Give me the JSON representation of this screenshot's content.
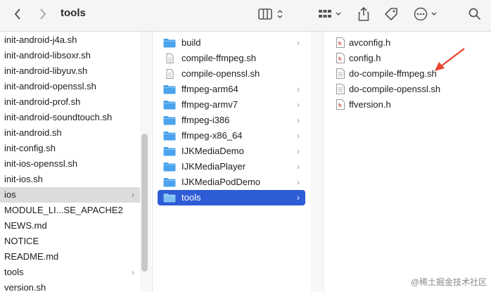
{
  "window": {
    "title": "tools"
  },
  "toolbar": {
    "back_icon": "chevron-left-icon",
    "forward_icon": "chevron-right-icon",
    "view_icon": "column-view-icon",
    "group_icon": "grid-group-icon",
    "share_icon": "share-icon",
    "tag_icon": "tag-icon",
    "more_icon": "ellipsis-icon",
    "search_icon": "search-icon"
  },
  "column1": {
    "items": [
      {
        "label": "init-android-j4a.sh",
        "folder": false
      },
      {
        "label": "init-android-libsoxr.sh",
        "folder": false
      },
      {
        "label": "init-android-libyuv.sh",
        "folder": false
      },
      {
        "label": "init-android-openssl.sh",
        "folder": false
      },
      {
        "label": "init-android-prof.sh",
        "folder": false
      },
      {
        "label": "init-android-soundtouch.sh",
        "folder": false
      },
      {
        "label": "init-android.sh",
        "folder": false
      },
      {
        "label": "init-config.sh",
        "folder": false
      },
      {
        "label": "init-ios-openssl.sh",
        "folder": false
      },
      {
        "label": "init-ios.sh",
        "folder": false
      },
      {
        "label": "ios",
        "folder": true,
        "selected": true
      },
      {
        "label": "MODULE_LI...SE_APACHE2",
        "folder": false
      },
      {
        "label": "NEWS.md",
        "folder": false
      },
      {
        "label": "NOTICE",
        "folder": false
      },
      {
        "label": "README.md",
        "folder": false
      },
      {
        "label": "tools",
        "folder": true
      },
      {
        "label": "version.sh",
        "folder": false
      }
    ]
  },
  "column2": {
    "items": [
      {
        "label": "build",
        "folder": true
      },
      {
        "label": "compile-ffmpeg.sh",
        "folder": false
      },
      {
        "label": "compile-openssl.sh",
        "folder": false
      },
      {
        "label": "ffmpeg-arm64",
        "folder": true
      },
      {
        "label": "ffmpeg-armv7",
        "folder": true
      },
      {
        "label": "ffmpeg-i386",
        "folder": true
      },
      {
        "label": "ffmpeg-x86_64",
        "folder": true
      },
      {
        "label": "IJKMediaDemo",
        "folder": true
      },
      {
        "label": "IJKMediaPlayer",
        "folder": true
      },
      {
        "label": "IJKMediaPodDemo",
        "folder": true
      },
      {
        "label": "tools",
        "folder": true,
        "selected": true
      }
    ]
  },
  "column3": {
    "items": [
      {
        "label": "avconfig.h",
        "type": "h"
      },
      {
        "label": "config.h",
        "type": "h"
      },
      {
        "label": "do-compile-ffmpeg.sh",
        "type": "sh"
      },
      {
        "label": "do-compile-openssl.sh",
        "type": "sh"
      },
      {
        "label": "ffversion.h",
        "type": "h"
      }
    ]
  },
  "watermark": "@稀土掘金技术社区",
  "colors": {
    "selection_blue": "#2e5cd6",
    "folder_blue": "#4aa3ec",
    "arrow_red": "#e8432e"
  }
}
